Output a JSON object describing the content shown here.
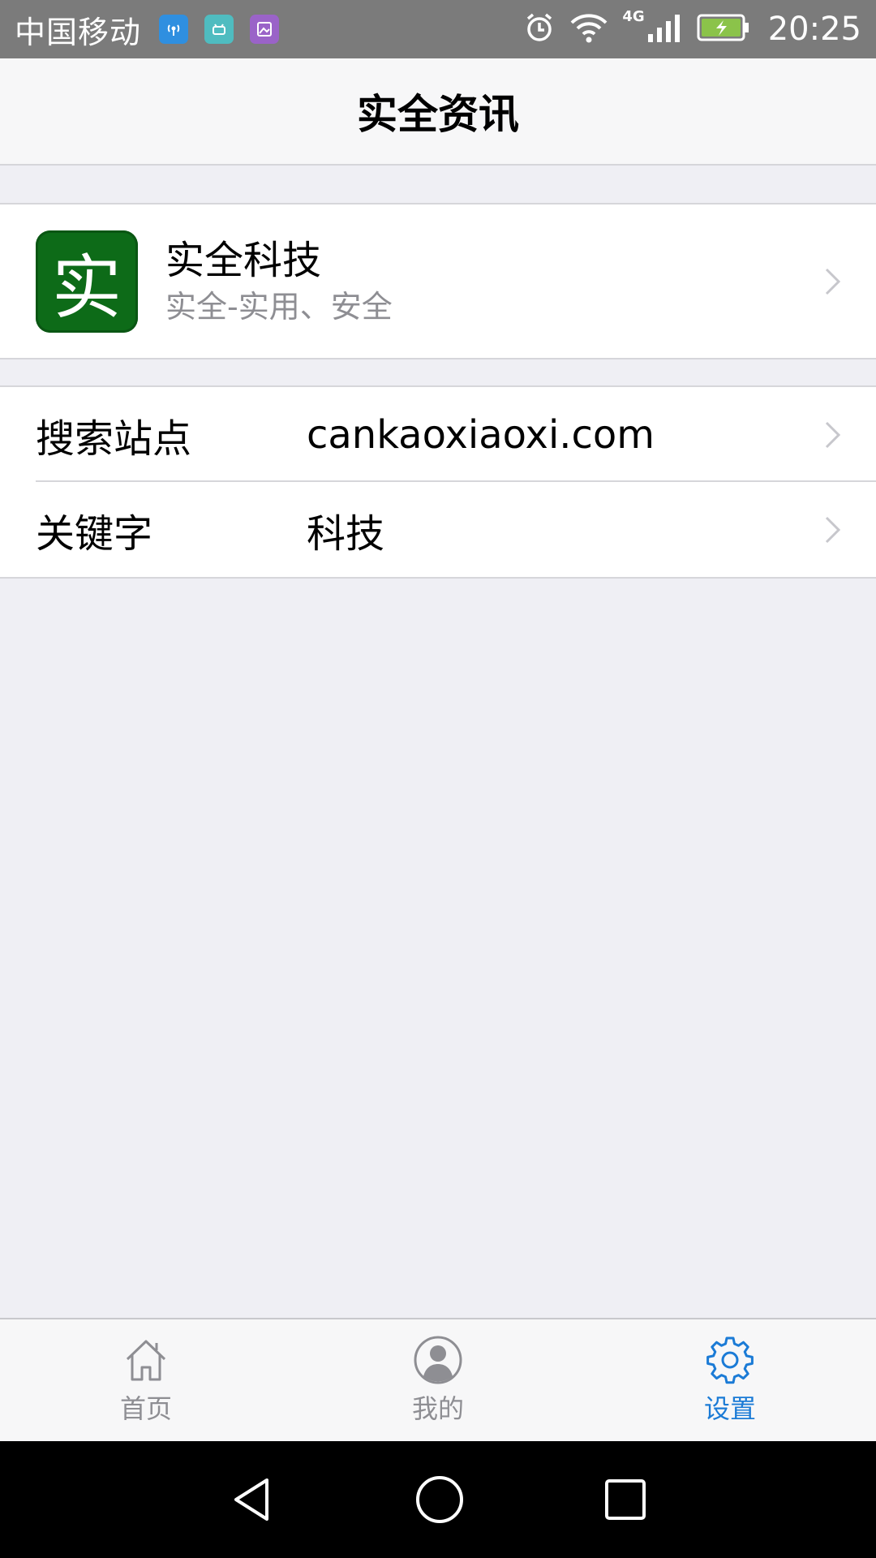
{
  "status_bar": {
    "carrier": "中国移动",
    "network_type": "4G",
    "time": "20:25",
    "battery_color": "#8bc34a"
  },
  "nav": {
    "title": "实全资讯"
  },
  "profile": {
    "logo_char": "实",
    "logo_color": "#0d6b18",
    "name": "实全科技",
    "description": "实全-实用、安全"
  },
  "settings": {
    "items": [
      {
        "label": "搜索站点",
        "value": "cankaoxiaoxi.com"
      },
      {
        "label": "关键字",
        "value": "科技"
      }
    ]
  },
  "tab_bar": {
    "active_color": "#1b7bd6",
    "tabs": [
      {
        "label": "首页",
        "icon": "home-icon",
        "active": false
      },
      {
        "label": "我的",
        "icon": "user-icon",
        "active": false
      },
      {
        "label": "设置",
        "icon": "gear-icon",
        "active": true
      }
    ]
  }
}
